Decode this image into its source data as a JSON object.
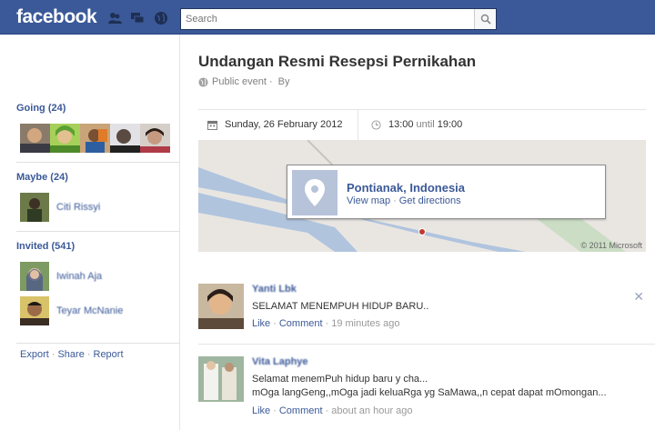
{
  "header": {
    "logo": "facebook",
    "search_placeholder": "Search",
    "colors": {
      "bar": "#3b5998",
      "link": "#3b5998"
    },
    "icons": [
      "friend-requests-icon",
      "messages-icon",
      "notifications-globe-icon",
      "search-icon"
    ]
  },
  "sidebar": {
    "going": {
      "label": "Going (24)"
    },
    "maybe": {
      "label": "Maybe (24)",
      "people": [
        {
          "name": "Citi Rissyi"
        }
      ]
    },
    "invited": {
      "label": "Invited (541)",
      "people": [
        {
          "name": "Iwinah Aja"
        },
        {
          "name": "Teyar McNanie"
        }
      ]
    },
    "links": {
      "export": "Export",
      "share": "Share",
      "report": "Report"
    }
  },
  "event": {
    "title": "Undangan Resmi Resepsi Pernikahan",
    "privacy": "Public event",
    "by": "By",
    "date": "Sunday, 26 February 2012",
    "time_start": "13:00",
    "until": "until",
    "time_end": "19:00",
    "location": {
      "name": "Pontianak, Indonesia",
      "view_map": "View map",
      "get_directions": "Get directions",
      "copyright": "© 2011 Microsoft"
    }
  },
  "posts": [
    {
      "author": "Yanti Lbk",
      "message": "SELAMAT MENEMPUH HIDUP BARU..",
      "like": "Like",
      "comment": "Comment",
      "time": "19 minutes ago"
    },
    {
      "author": "Vita Laphye",
      "message_lines": [
        "Selamat menemPuh hidup baru y cha...",
        "mOga langGeng,,mOga jadi keluaRga yg SaMawa,,n cepat dapat mOmongan..."
      ],
      "like": "Like",
      "comment": "Comment",
      "time": "about an hour ago"
    }
  ]
}
